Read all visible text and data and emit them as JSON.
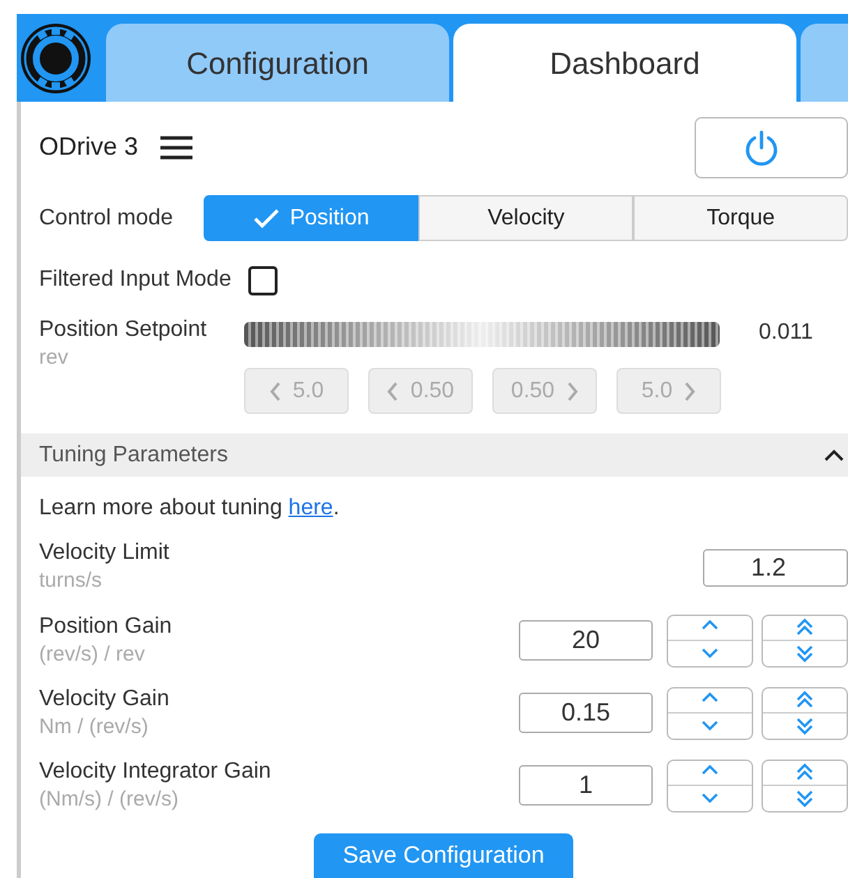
{
  "tabs": [
    {
      "label": "Configuration",
      "selected": false
    },
    {
      "label": "Dashboard",
      "selected": true
    }
  ],
  "device": {
    "name": "ODrive 3"
  },
  "control_mode": {
    "label": "Control mode",
    "options": [
      {
        "label": "Position",
        "selected": true
      },
      {
        "label": "Velocity",
        "selected": false
      },
      {
        "label": "Torque",
        "selected": false
      }
    ]
  },
  "filtered_input": {
    "label": "Filtered Input Mode",
    "checked": false
  },
  "setpoint": {
    "label": "Position Setpoint",
    "unit": "rev",
    "reading": "0.011",
    "steps": [
      {
        "label": "5.0",
        "kind": "decrease",
        "disabled": true
      },
      {
        "label": "0.50",
        "kind": "decrease",
        "disabled": true
      },
      {
        "label": "0.50",
        "kind": "increase",
        "disabled": true
      },
      {
        "label": "5.0",
        "kind": "increase",
        "disabled": true
      }
    ]
  },
  "tuning": {
    "title": "Tuning Parameters",
    "expanded": true,
    "intro": "Learn more about tuning ",
    "link": "here",
    "intro_end": ".",
    "parameters": [
      {
        "label": "Velocity Limit",
        "unit": "turns/s",
        "value": "1.2",
        "kind": "plain"
      },
      {
        "label": "Position Gain",
        "unit": "(rev/s) / rev",
        "value": "20",
        "kind": "stepper"
      },
      {
        "label": "Velocity Gain",
        "unit": "Nm / (rev/s)",
        "value": "0.15",
        "kind": "stepper"
      },
      {
        "label": "Velocity Integrator Gain",
        "unit": "(Nm/s) / (rev/s)",
        "value": "1",
        "kind": "stepper"
      }
    ]
  },
  "save_button": {
    "label": "Save Configuration"
  }
}
